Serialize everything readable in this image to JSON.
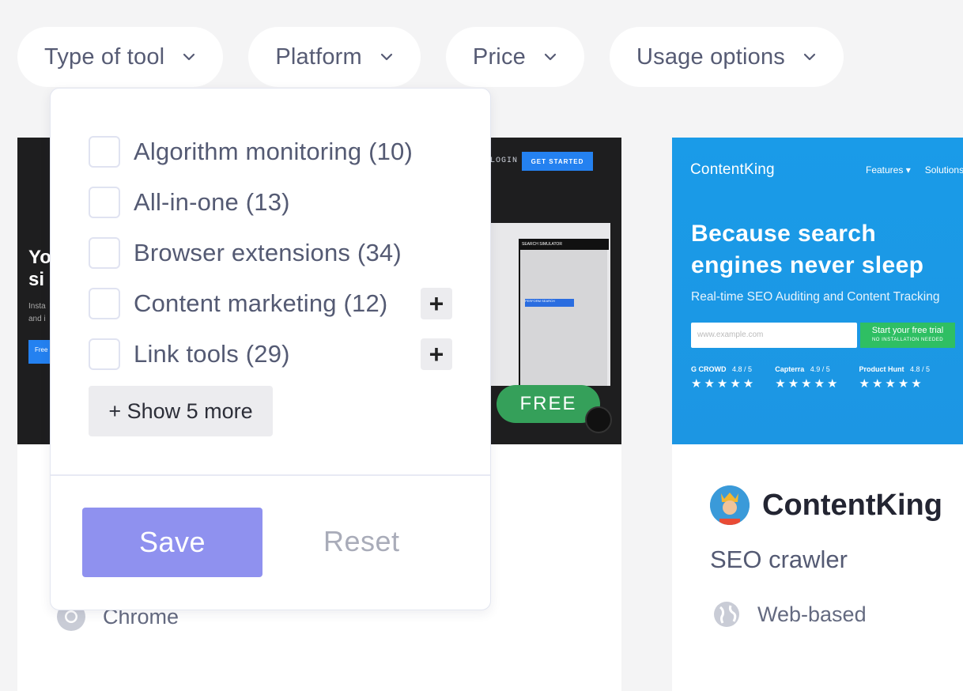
{
  "filters": [
    {
      "label": "Type of tool"
    },
    {
      "label": "Platform"
    },
    {
      "label": "Price"
    },
    {
      "label": "Usage options"
    }
  ],
  "dropdown": {
    "options": [
      {
        "label": "Algorithm monitoring (10)",
        "checked": false,
        "expandable": false
      },
      {
        "label": "All-in-one (13)",
        "checked": false,
        "expandable": false
      },
      {
        "label": "Browser extensions (34)",
        "checked": false,
        "expandable": false
      },
      {
        "label": "Content marketing (12)",
        "checked": false,
        "expandable": true
      },
      {
        "label": "Link tools (29)",
        "checked": false,
        "expandable": true
      }
    ],
    "show_more_label": "+ Show 5 more",
    "save_label": "Save",
    "reset_label": "Reset"
  },
  "card1": {
    "nav_login": "LOGIN",
    "nav_cta": "GET STARTED",
    "hero_text": "Yo\nsi",
    "hero_small": "Insta\nand i",
    "hero_btn": "Free",
    "panel_title": "SEARCH SIMULATOR",
    "panel_btn": "PERFORM SEARCH",
    "badge": "FREE",
    "platform": "Chrome"
  },
  "card2": {
    "logo": "ContentKing",
    "nav": [
      "Features ▾",
      "Solutions"
    ],
    "headline": "Because search engines never sleep",
    "subline": "Real-time SEO Auditing and Content Tracking",
    "input_placeholder": "www.example.com",
    "cta": "Start your free trial",
    "cta_small": "NO INSTALLATION NEEDED",
    "ratings": [
      {
        "source": "G CROWD",
        "score": "4.8 / 5",
        "stars": "★★★★★"
      },
      {
        "source": "Capterra",
        "score": "4.9 / 5",
        "stars": "★★★★★"
      },
      {
        "source": "Product Hunt",
        "score": "4.8 / 5",
        "stars": "★★★★★"
      }
    ],
    "title": "ContentKing",
    "category": "SEO crawler",
    "platform": "Web-based"
  },
  "colors": {
    "accent": "#8f91ef",
    "free_badge": "#35a05a",
    "contentking_blue": "#1a9be8"
  }
}
